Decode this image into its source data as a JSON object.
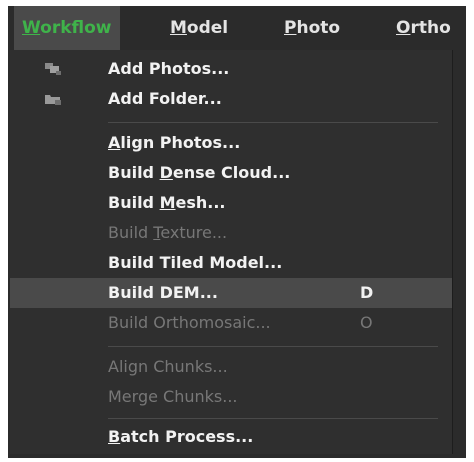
{
  "menubar": {
    "items": [
      {
        "pre": "",
        "ul": "W",
        "post": "orkflow"
      },
      {
        "pre": "",
        "ul": "M",
        "post": "odel"
      },
      {
        "pre": "",
        "ul": "P",
        "post": "hoto"
      },
      {
        "pre": "",
        "ul": "O",
        "post": "rtho"
      }
    ]
  },
  "menu": {
    "items": [
      {
        "pre": "Add Photos...",
        "ul": "",
        "post": "",
        "shortcut": "",
        "icon": "add-photos-icon"
      },
      {
        "pre": "Add Folder...",
        "ul": "",
        "post": "",
        "shortcut": "",
        "icon": "add-folder-icon"
      },
      {
        "pre": "",
        "ul": "A",
        "post": "lign Photos...",
        "shortcut": ""
      },
      {
        "pre": "Build ",
        "ul": "D",
        "post": "ense Cloud...",
        "shortcut": ""
      },
      {
        "pre": "Build ",
        "ul": "M",
        "post": "esh...",
        "shortcut": ""
      },
      {
        "pre": "Build ",
        "ul": "T",
        "post": "exture...",
        "shortcut": "",
        "disabled": true
      },
      {
        "pre": "Build Tiled Model...",
        "ul": "",
        "post": "",
        "shortcut": ""
      },
      {
        "pre": "Build DEM...",
        "ul": "",
        "post": "",
        "shortcut": "D",
        "highlighted": true
      },
      {
        "pre": "Build Orthomosaic...",
        "ul": "",
        "post": "",
        "shortcut": "O",
        "disabled": true
      },
      {
        "pre": "Align Chunks...",
        "ul": "",
        "post": "",
        "shortcut": "",
        "disabled": true
      },
      {
        "pre": "Merge Chunks...",
        "ul": "",
        "post": "",
        "shortcut": "",
        "disabled": true
      },
      {
        "pre": "",
        "ul": "B",
        "post": "atch Process...",
        "shortcut": ""
      }
    ]
  },
  "colors": {
    "accent": "#3fb34a",
    "menu_bg": "#2f2f2f",
    "highlight_bg": "#4a4a4a",
    "disabled_text": "#777777"
  }
}
